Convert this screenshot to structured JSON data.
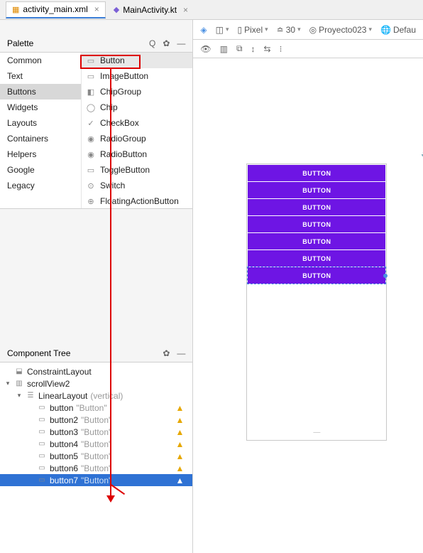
{
  "tabs": [
    {
      "label": "activity_main.xml",
      "icon": "📄",
      "active": true
    },
    {
      "label": "MainActivity.kt",
      "icon": "📘",
      "active": false
    }
  ],
  "palette": {
    "title": "Palette",
    "categories": [
      "Common",
      "Text",
      "Buttons",
      "Widgets",
      "Layouts",
      "Containers",
      "Helpers",
      "Google",
      "Legacy"
    ],
    "selected_category": "Buttons",
    "items": [
      {
        "label": "Button",
        "icon": "▭"
      },
      {
        "label": "ImageButton",
        "icon": "▭"
      },
      {
        "label": "ChipGroup",
        "icon": "◧"
      },
      {
        "label": "Chip",
        "icon": "◯"
      },
      {
        "label": "CheckBox",
        "icon": "✓"
      },
      {
        "label": "RadioGroup",
        "icon": "◉"
      },
      {
        "label": "RadioButton",
        "icon": "◉"
      },
      {
        "label": "ToggleButton",
        "icon": "▭"
      },
      {
        "label": "Switch",
        "icon": "⊙"
      },
      {
        "label": "FloatingActionButton",
        "icon": "⊕"
      }
    ],
    "selected_item": "Button"
  },
  "componentTree": {
    "title": "Component Tree",
    "root": "ConstraintLayout",
    "scroll": "scrollView2",
    "linear": {
      "name": "LinearLayout",
      "hint": "(vertical)"
    },
    "buttons": [
      {
        "name": "button",
        "text": "\"Button\""
      },
      {
        "name": "button2",
        "text": "\"Button\""
      },
      {
        "name": "button3",
        "text": "\"Button\""
      },
      {
        "name": "button4",
        "text": "\"Button\""
      },
      {
        "name": "button5",
        "text": "\"Button\""
      },
      {
        "name": "button6",
        "text": "\"Button\""
      },
      {
        "name": "button7",
        "text": "\"Button\""
      }
    ],
    "selected": "button7"
  },
  "rightToolbar": {
    "device": "Pixel",
    "api": "30",
    "theme": "Proyecto023",
    "default": "Defau"
  },
  "preview": {
    "button_label": "BUTTON",
    "count": 7
  }
}
